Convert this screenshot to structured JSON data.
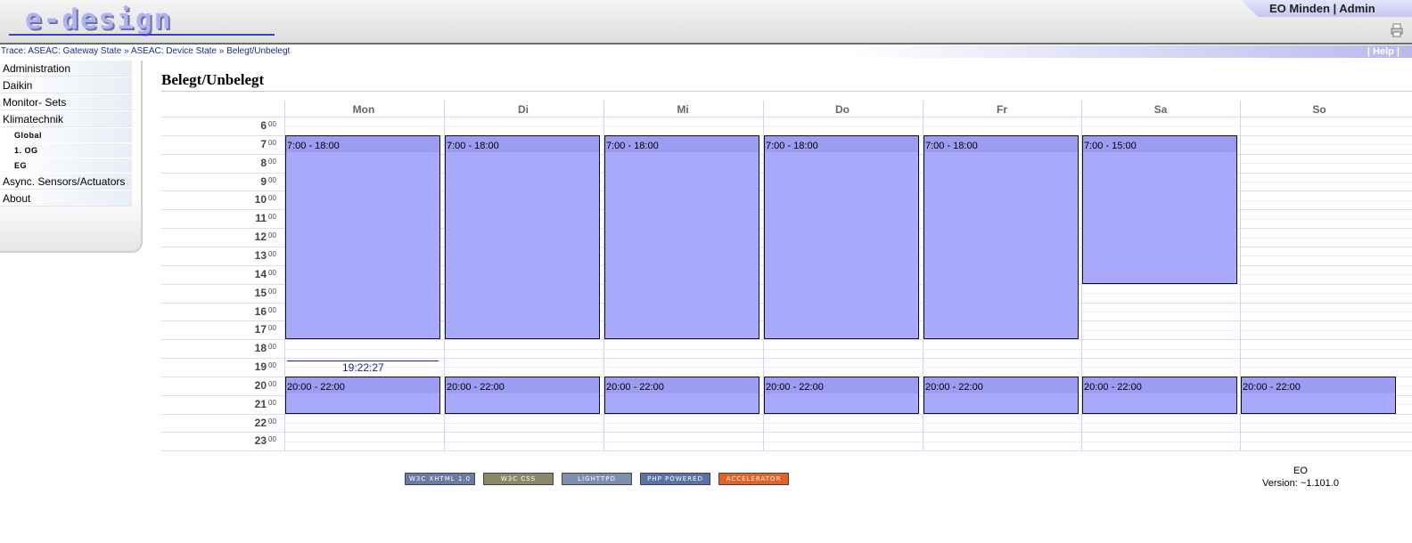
{
  "header": {
    "logo_text": "e-design",
    "user_text": "EO Minden | Admin",
    "print_icon": "printer-icon"
  },
  "trace": {
    "label": "Trace:",
    "items": [
      "ASEAC: Gateway State",
      "ASEAC: Device State",
      "Belegt/Unbelegt"
    ],
    "separator": "»",
    "help_label": "| Help |"
  },
  "sidebar": {
    "items": [
      "Administration",
      "Daikin",
      "Monitor- Sets",
      "Klimatechnik"
    ],
    "subitems": [
      "Global",
      "1. OG",
      "EG"
    ],
    "items_after": [
      "Async. Sensors/Actuators",
      "About"
    ]
  },
  "page": {
    "title": "Belegt/Unbelegt"
  },
  "calendar": {
    "days": [
      "Mon",
      "Di",
      "Mi",
      "Do",
      "Fr",
      "Sa",
      "So"
    ],
    "hours": [
      "6",
      "7",
      "8",
      "9",
      "10",
      "11",
      "12",
      "13",
      "14",
      "15",
      "16",
      "17",
      "18",
      "19",
      "20",
      "21",
      "22",
      "23"
    ],
    "minutes_label": "00",
    "current_time": "19:22:27",
    "events": [
      {
        "day": 0,
        "start": 7,
        "end": 18,
        "label": "7:00 - 18:00"
      },
      {
        "day": 1,
        "start": 7,
        "end": 18,
        "label": "7:00 - 18:00"
      },
      {
        "day": 2,
        "start": 7,
        "end": 18,
        "label": "7:00 - 18:00"
      },
      {
        "day": 3,
        "start": 7,
        "end": 18,
        "label": "7:00 - 18:00"
      },
      {
        "day": 4,
        "start": 7,
        "end": 18,
        "label": "7:00 - 18:00"
      },
      {
        "day": 5,
        "start": 7,
        "end": 15,
        "label": "7:00 - 15:00"
      },
      {
        "day": 0,
        "start": 20,
        "end": 22,
        "label": "20:00 - 22:00"
      },
      {
        "day": 1,
        "start": 20,
        "end": 22,
        "label": "20:00 - 22:00"
      },
      {
        "day": 2,
        "start": 20,
        "end": 22,
        "label": "20:00 - 22:00"
      },
      {
        "day": 3,
        "start": 20,
        "end": 22,
        "label": "20:00 - 22:00"
      },
      {
        "day": 4,
        "start": 20,
        "end": 22,
        "label": "20:00 - 22:00"
      },
      {
        "day": 5,
        "start": 20,
        "end": 22,
        "label": "20:00 - 22:00"
      },
      {
        "day": 6,
        "start": 20,
        "end": 22,
        "label": "20:00 - 22:00"
      }
    ]
  },
  "footer": {
    "badges": [
      {
        "label": "W3C XHTML 1.0",
        "color": "#6c7ba6"
      },
      {
        "label": "W3C CSS",
        "color": "#8a8a6a"
      },
      {
        "label": "LIGHTTPD",
        "color": "#7d8fae"
      },
      {
        "label": "PHP POWERED",
        "color": "#5a74a8"
      },
      {
        "label": "ACCELERATOR",
        "color": "#e2632a"
      }
    ],
    "app_name": "EO",
    "version": "Version: ~1.101.0"
  },
  "colors": {
    "event_fill": "#aaaafc",
    "event_header": "#9c9cf2",
    "accent": "#1b2a8a"
  }
}
